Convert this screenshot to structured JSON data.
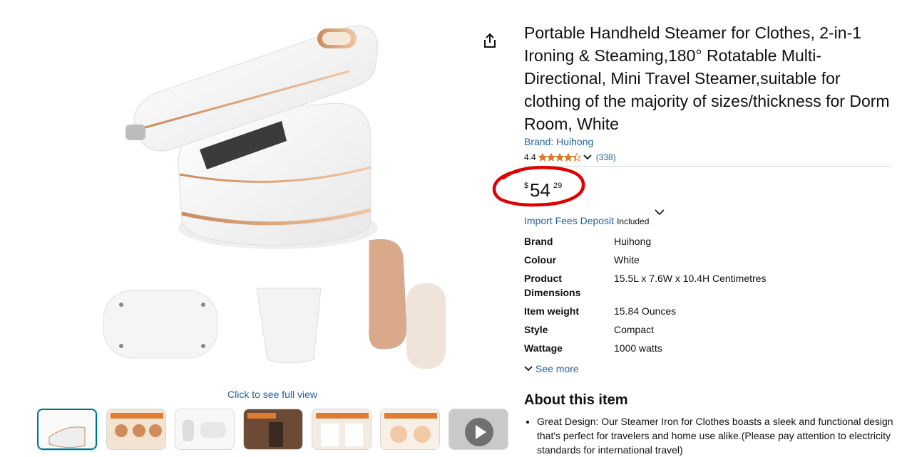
{
  "gallery": {
    "view_full_label": "Click to see full view",
    "thumbnails": [
      {
        "label": "main-white-steamer",
        "active": true
      },
      {
        "label": "Portable Mini Steam Iron"
      },
      {
        "label": "dimensions"
      },
      {
        "label": "2 in 1 Design"
      },
      {
        "label": "Functional Clothes Steamer"
      },
      {
        "label": "Removing bacteria and mites"
      },
      {
        "label": "video"
      }
    ]
  },
  "product": {
    "title": "Portable Handheld Steamer for Clothes, 2-in-1 Ironing & Steaming,180° Rotatable Multi-Directional, Mini Travel Steamer,suitable for clothing of the majority of sizes/thickness for Dorm Room, White",
    "brand_link": "Brand: Huihong",
    "rating": "4.4",
    "rating_stars": 4.4,
    "rating_count": "(338)",
    "price": {
      "symbol": "$",
      "whole": "54",
      "fraction": "29"
    },
    "import_fees_link": "Import Fees Deposit",
    "import_fees_status": "Included"
  },
  "specs": [
    {
      "key": "Brand",
      "value": "Huihong"
    },
    {
      "key": "Colour",
      "value": "White"
    },
    {
      "key": "Product Dimensions",
      "value": "15.5L x 7.6W x 10.4H Centimetres"
    },
    {
      "key": "Item weight",
      "value": "15.84 Ounces"
    },
    {
      "key": "Style",
      "value": "Compact"
    },
    {
      "key": "Wattage",
      "value": "1000 watts"
    }
  ],
  "see_more_label": "See more",
  "about": {
    "title": "About this item",
    "bullets": [
      "Great Design: Our Steamer Iron for Clothes boasts a sleek and functional design that's perfect for travelers and home use alike.(Please pay attention to electricity standards for international travel)"
    ]
  },
  "colors": {
    "link": "#2162a1",
    "star": "#de7921",
    "annotation_circle": "#e00000",
    "thumb_active_border": "#007185"
  }
}
